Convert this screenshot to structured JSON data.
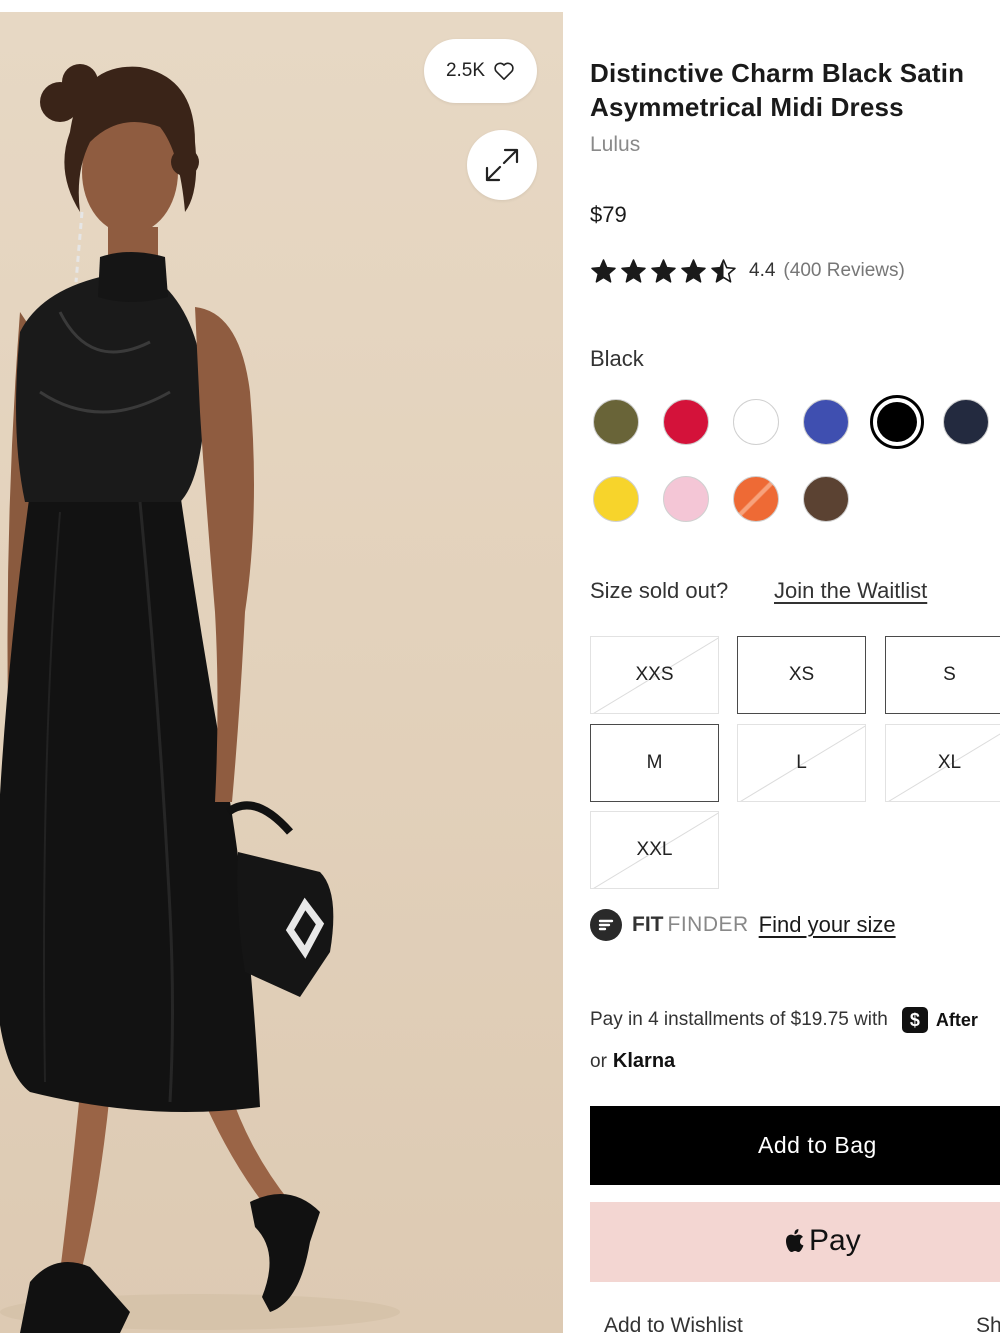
{
  "product": {
    "title": "Distinctive Charm Black Satin Asymmetrical Midi Dress",
    "brand": "Lulus",
    "price": "$79",
    "rating_value": "4.4",
    "rating_stars": 4.5,
    "reviews": "(400 Reviews)",
    "favorites_count": "2.5K"
  },
  "colors": {
    "selected_label": "Black",
    "swatches": [
      {
        "name": "olive",
        "hex": "#696438"
      },
      {
        "name": "red",
        "hex": "#d4123a"
      },
      {
        "name": "white",
        "hex": "#ffffff"
      },
      {
        "name": "blue",
        "hex": "#3f4fb0"
      },
      {
        "name": "black",
        "hex": "#000000",
        "selected": true
      },
      {
        "name": "navy",
        "hex": "#232a3f"
      },
      {
        "name": "yellow",
        "hex": "#f7d42b"
      },
      {
        "name": "pink",
        "hex": "#f4c6d6"
      },
      {
        "name": "orange",
        "hex": "#ee6a35"
      },
      {
        "name": "brown",
        "hex": "#5b4232"
      }
    ]
  },
  "sizes": {
    "question": "Size sold out?",
    "waitlist_link": "Join the Waitlist",
    "options": [
      {
        "label": "XXS",
        "available": false
      },
      {
        "label": "XS",
        "available": true
      },
      {
        "label": "S",
        "available": true
      },
      {
        "label": "M",
        "available": true
      },
      {
        "label": "L",
        "available": false
      },
      {
        "label": "XL",
        "available": false
      },
      {
        "label": "XXL",
        "available": false
      }
    ]
  },
  "fit_finder": {
    "brand_bold": "FIT",
    "brand_light": "FINDER",
    "link": "Find your size"
  },
  "payments": {
    "installments_text": "Pay in 4 installments of $19.75 with",
    "afterpay_label": "After",
    "or_text": "or",
    "klarna_label": "Klarna"
  },
  "actions": {
    "add_to_bag": "Add to Bag",
    "apple_pay": "Pay",
    "add_to_wishlist": "Add to Wishlist",
    "share_partial": "Sh"
  }
}
